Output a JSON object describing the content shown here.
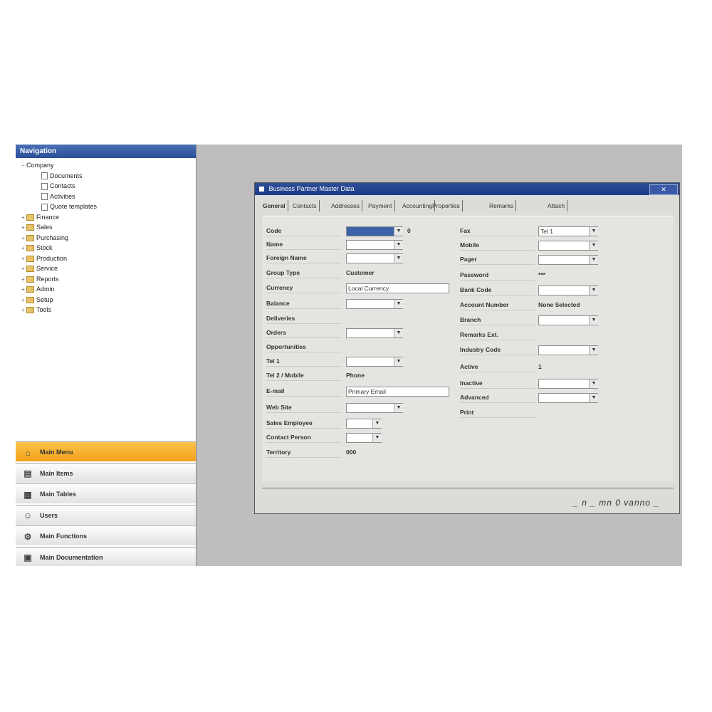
{
  "nav": {
    "header_title": "Navigation",
    "tree": [
      {
        "label": "Company",
        "level": 0,
        "kind": "toggle"
      },
      {
        "label": "Documents",
        "level": 1,
        "kind": "doc"
      },
      {
        "label": "Contacts",
        "level": 1,
        "kind": "doc"
      },
      {
        "label": "Activities",
        "level": 1,
        "kind": "doc"
      },
      {
        "label": "Quote templates",
        "level": 1,
        "kind": "doc"
      },
      {
        "label": "Finance",
        "level": 0,
        "kind": "folder"
      },
      {
        "label": "Sales",
        "level": 0,
        "kind": "folder"
      },
      {
        "label": "Purchasing",
        "level": 0,
        "kind": "folder"
      },
      {
        "label": "Stock",
        "level": 0,
        "kind": "folder"
      },
      {
        "label": "Production",
        "level": 0,
        "kind": "folder"
      },
      {
        "label": "Service",
        "level": 0,
        "kind": "folder"
      },
      {
        "label": "Reports",
        "level": 0,
        "kind": "folder"
      },
      {
        "label": "Admin",
        "level": 0,
        "kind": "folder"
      },
      {
        "label": "Setup",
        "level": 0,
        "kind": "folder"
      },
      {
        "label": "Tools",
        "level": 0,
        "kind": "folder"
      }
    ],
    "buttons": [
      {
        "label": "Main Menu",
        "icon": "home-icon",
        "glyph": "⌂",
        "active": true
      },
      {
        "label": "Main Items",
        "icon": "item-icon",
        "glyph": "▤",
        "active": false
      },
      {
        "label": "Main Tables",
        "icon": "table-icon",
        "glyph": "▦",
        "active": false
      },
      {
        "label": "Users",
        "icon": "user-icon",
        "glyph": "☺",
        "active": false
      },
      {
        "label": "Main Functions",
        "icon": "function-icon",
        "glyph": "⚙",
        "active": false
      },
      {
        "label": "Main Documentation",
        "icon": "document-icon",
        "glyph": "▣",
        "active": false
      }
    ]
  },
  "dialog": {
    "title": "Business Partner Master Data",
    "close_label": "✕",
    "tabs": [
      "General",
      "Contacts",
      "Addresses",
      "Payment",
      "Accounting",
      "Properties",
      "Remarks",
      "Attach"
    ],
    "left_fields": [
      {
        "label": "Code",
        "value": "",
        "type": "input-sel",
        "width": 80,
        "extra": "0"
      },
      {
        "label": "Name",
        "value": "",
        "type": "input",
        "width": 80
      },
      {
        "label": "Foreign Name",
        "value": "",
        "type": "input",
        "width": 80
      },
      {
        "label": "Group Type",
        "value": "Customer",
        "type": "text"
      },
      {
        "label": "Currency",
        "value": "Local Currency",
        "type": "input-wide",
        "width": 145
      },
      {
        "label": "Balance",
        "value": "",
        "type": "input",
        "width": 80
      },
      {
        "label": "Deliveries",
        "value": "",
        "type": "text"
      },
      {
        "label": "Orders",
        "value": "",
        "type": "input",
        "width": 80
      },
      {
        "label": "Opportunities",
        "value": "",
        "type": "text"
      },
      {
        "label": "Tel 1",
        "value": "",
        "type": "input",
        "width": 80
      },
      {
        "label": "Tel 2 / Mobile",
        "value": "Phone",
        "type": "text"
      },
      {
        "label": "E-mail",
        "value": "Primary Email",
        "type": "input-wide",
        "width": 118
      },
      {
        "label": "Web Site",
        "value": "",
        "type": "input",
        "width": 80
      },
      {
        "label": "Sales Employee",
        "value": "",
        "type": "input",
        "width": 50
      },
      {
        "label": "Contact Person",
        "value": "",
        "type": "input",
        "width": 50
      },
      {
        "label": "Territory",
        "value": "000",
        "type": "text"
      }
    ],
    "right_fields": [
      {
        "label": "Fax",
        "value": "Tel 1",
        "type": "input"
      },
      {
        "label": "Mobile",
        "value": "",
        "type": "input"
      },
      {
        "label": "Pager",
        "value": "",
        "type": "input"
      },
      {
        "label": "Password",
        "value": "***",
        "type": "text"
      },
      {
        "label": "Bank Code",
        "value": "",
        "type": "input"
      },
      {
        "label": "Account Number",
        "value": "None Selected",
        "type": "text"
      },
      {
        "label": "Branch",
        "value": "",
        "type": "input"
      },
      {
        "label": "Remarks Ext.",
        "value": "",
        "type": "text"
      },
      {
        "label": "Industry Code",
        "value": "",
        "type": "input"
      },
      {
        "label": "Active",
        "value": "1",
        "type": "text"
      },
      {
        "label": "Inactive",
        "value": "",
        "type": "input"
      },
      {
        "label": "Advanced",
        "value": "",
        "type": "input"
      },
      {
        "label": "Print",
        "value": "",
        "type": "none"
      }
    ],
    "status_text": "_ n _ mn 0 vanno _"
  }
}
